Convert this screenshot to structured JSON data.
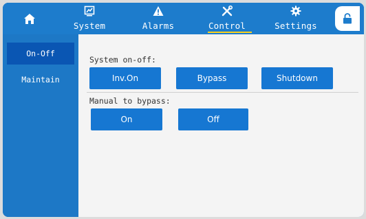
{
  "nav": {
    "tabs": [
      {
        "label": "System",
        "icon": "monitor-chart-icon"
      },
      {
        "label": "Alarms",
        "icon": "warning-icon"
      },
      {
        "label": "Control",
        "icon": "tools-icon"
      },
      {
        "label": "Settings",
        "icon": "gear-icon"
      }
    ],
    "active_tab": "Control"
  },
  "sidebar": {
    "items": [
      {
        "label": "On-Off"
      },
      {
        "label": "Maintain"
      }
    ],
    "active_item": "On-Off"
  },
  "system_onoff": {
    "label": "System on-off:",
    "buttons": [
      "Inv.On",
      "Bypass",
      "Shutdown"
    ]
  },
  "manual_bypass": {
    "label": "Manual to bypass:",
    "buttons": [
      "On",
      "Off"
    ]
  },
  "colors": {
    "frame_blue": "#1d78c6",
    "button_blue": "#1677d2",
    "active_side_item": "#0a56b3",
    "active_tab_underline": "#ffd21a",
    "panel_bg": "#f4f4f4"
  }
}
